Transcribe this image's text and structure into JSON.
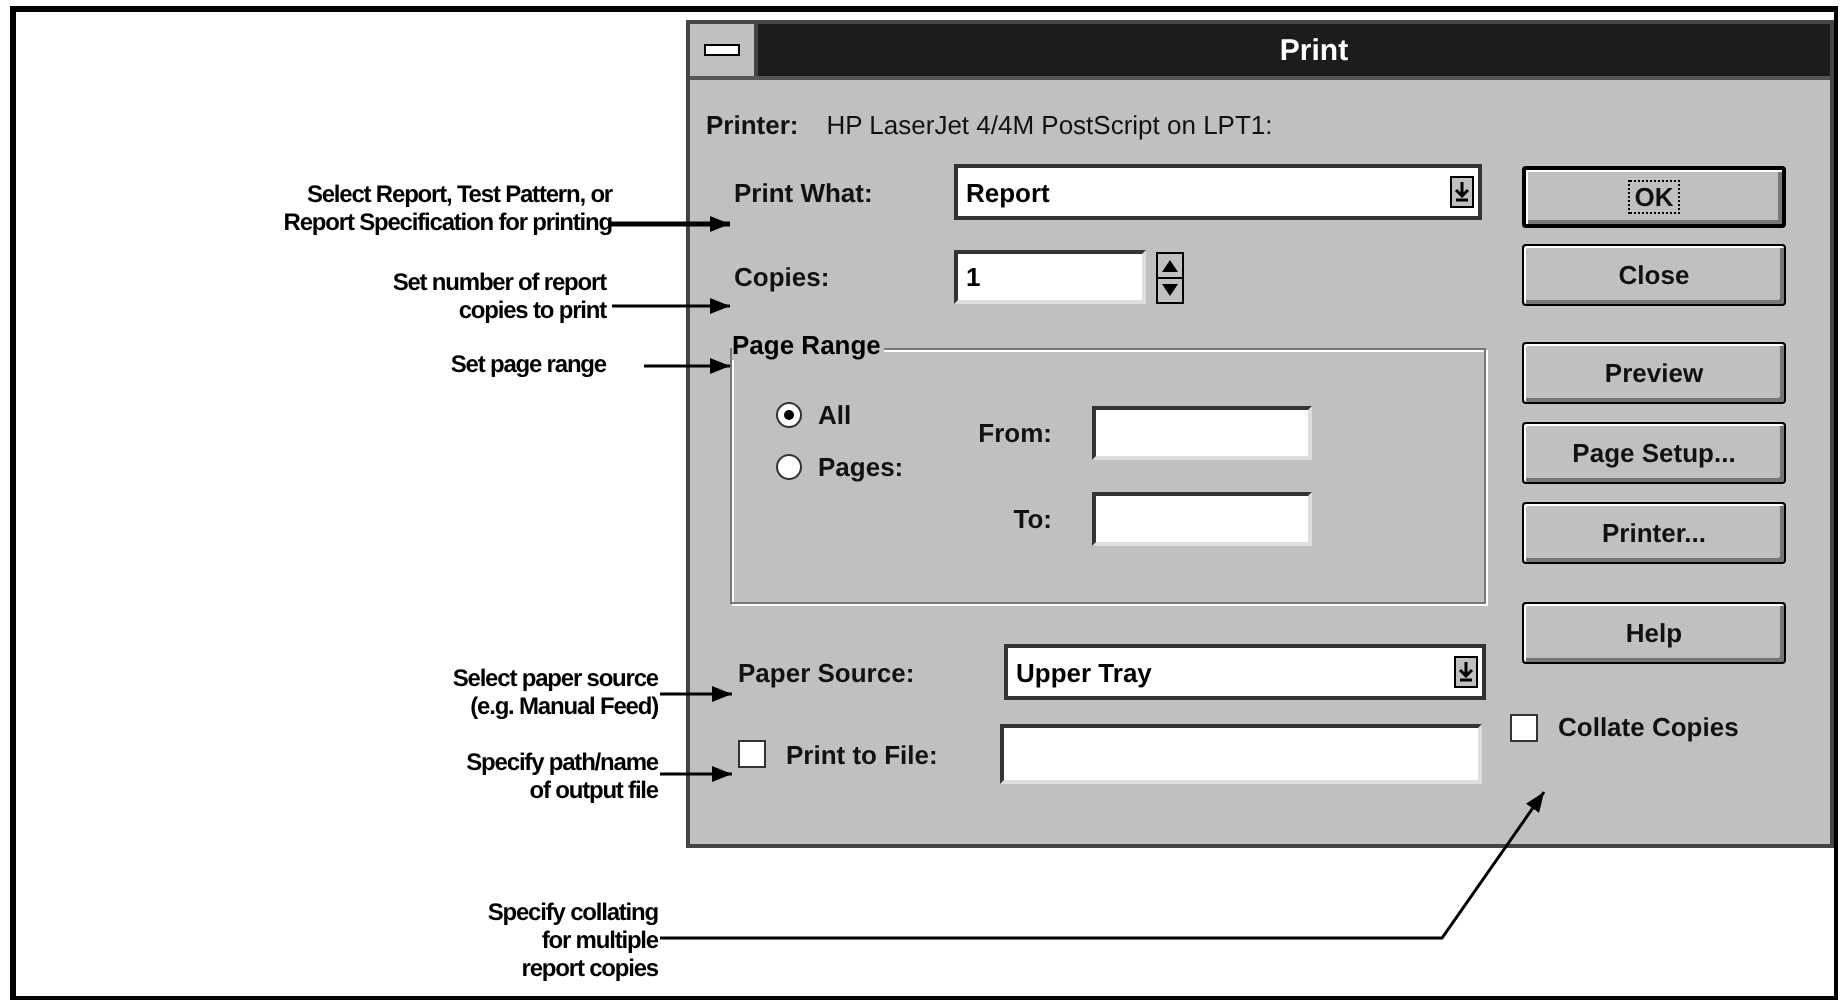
{
  "callouts": [
    {
      "lines": [
        "Select Report, Test Pattern, or",
        "Report Specification for printing"
      ]
    },
    {
      "lines": [
        "Set number of report",
        "copies to print"
      ]
    },
    {
      "lines": [
        "Set page range"
      ]
    },
    {
      "lines": [
        "Select paper source",
        "(e.g. Manual Feed)"
      ]
    },
    {
      "lines": [
        "Specify path/name",
        "of output file"
      ]
    },
    {
      "lines": [
        "Specify collating",
        "for multiple",
        "report copies"
      ]
    }
  ],
  "dialog": {
    "title": "Print",
    "printer": {
      "label": "Printer:",
      "value": "HP LaserJet 4/4M PostScript on LPT1:"
    },
    "print_what": {
      "label": "Print What:",
      "value": "Report"
    },
    "copies": {
      "label": "Copies:",
      "value": "1"
    },
    "page_range": {
      "label": "Page Range",
      "options": [
        {
          "label": "All",
          "selected": true
        },
        {
          "label": "Pages:",
          "selected": false
        }
      ],
      "from_label": "From:",
      "to_label": "To:"
    },
    "paper_source": {
      "label": "Paper Source:",
      "value": "Upper Tray"
    },
    "print_to_file": {
      "label": "Print to File:",
      "checked": false
    },
    "buttons": [
      {
        "label": "OK",
        "default": true
      },
      {
        "label": "Close",
        "default": false
      },
      {
        "label": "Preview",
        "default": false
      },
      {
        "label": "Page Setup...",
        "default": false
      },
      {
        "label": "Printer...",
        "default": false
      },
      {
        "label": "Help",
        "default": false
      }
    ],
    "collate": {
      "label": "Collate Copies",
      "checked": false
    }
  }
}
